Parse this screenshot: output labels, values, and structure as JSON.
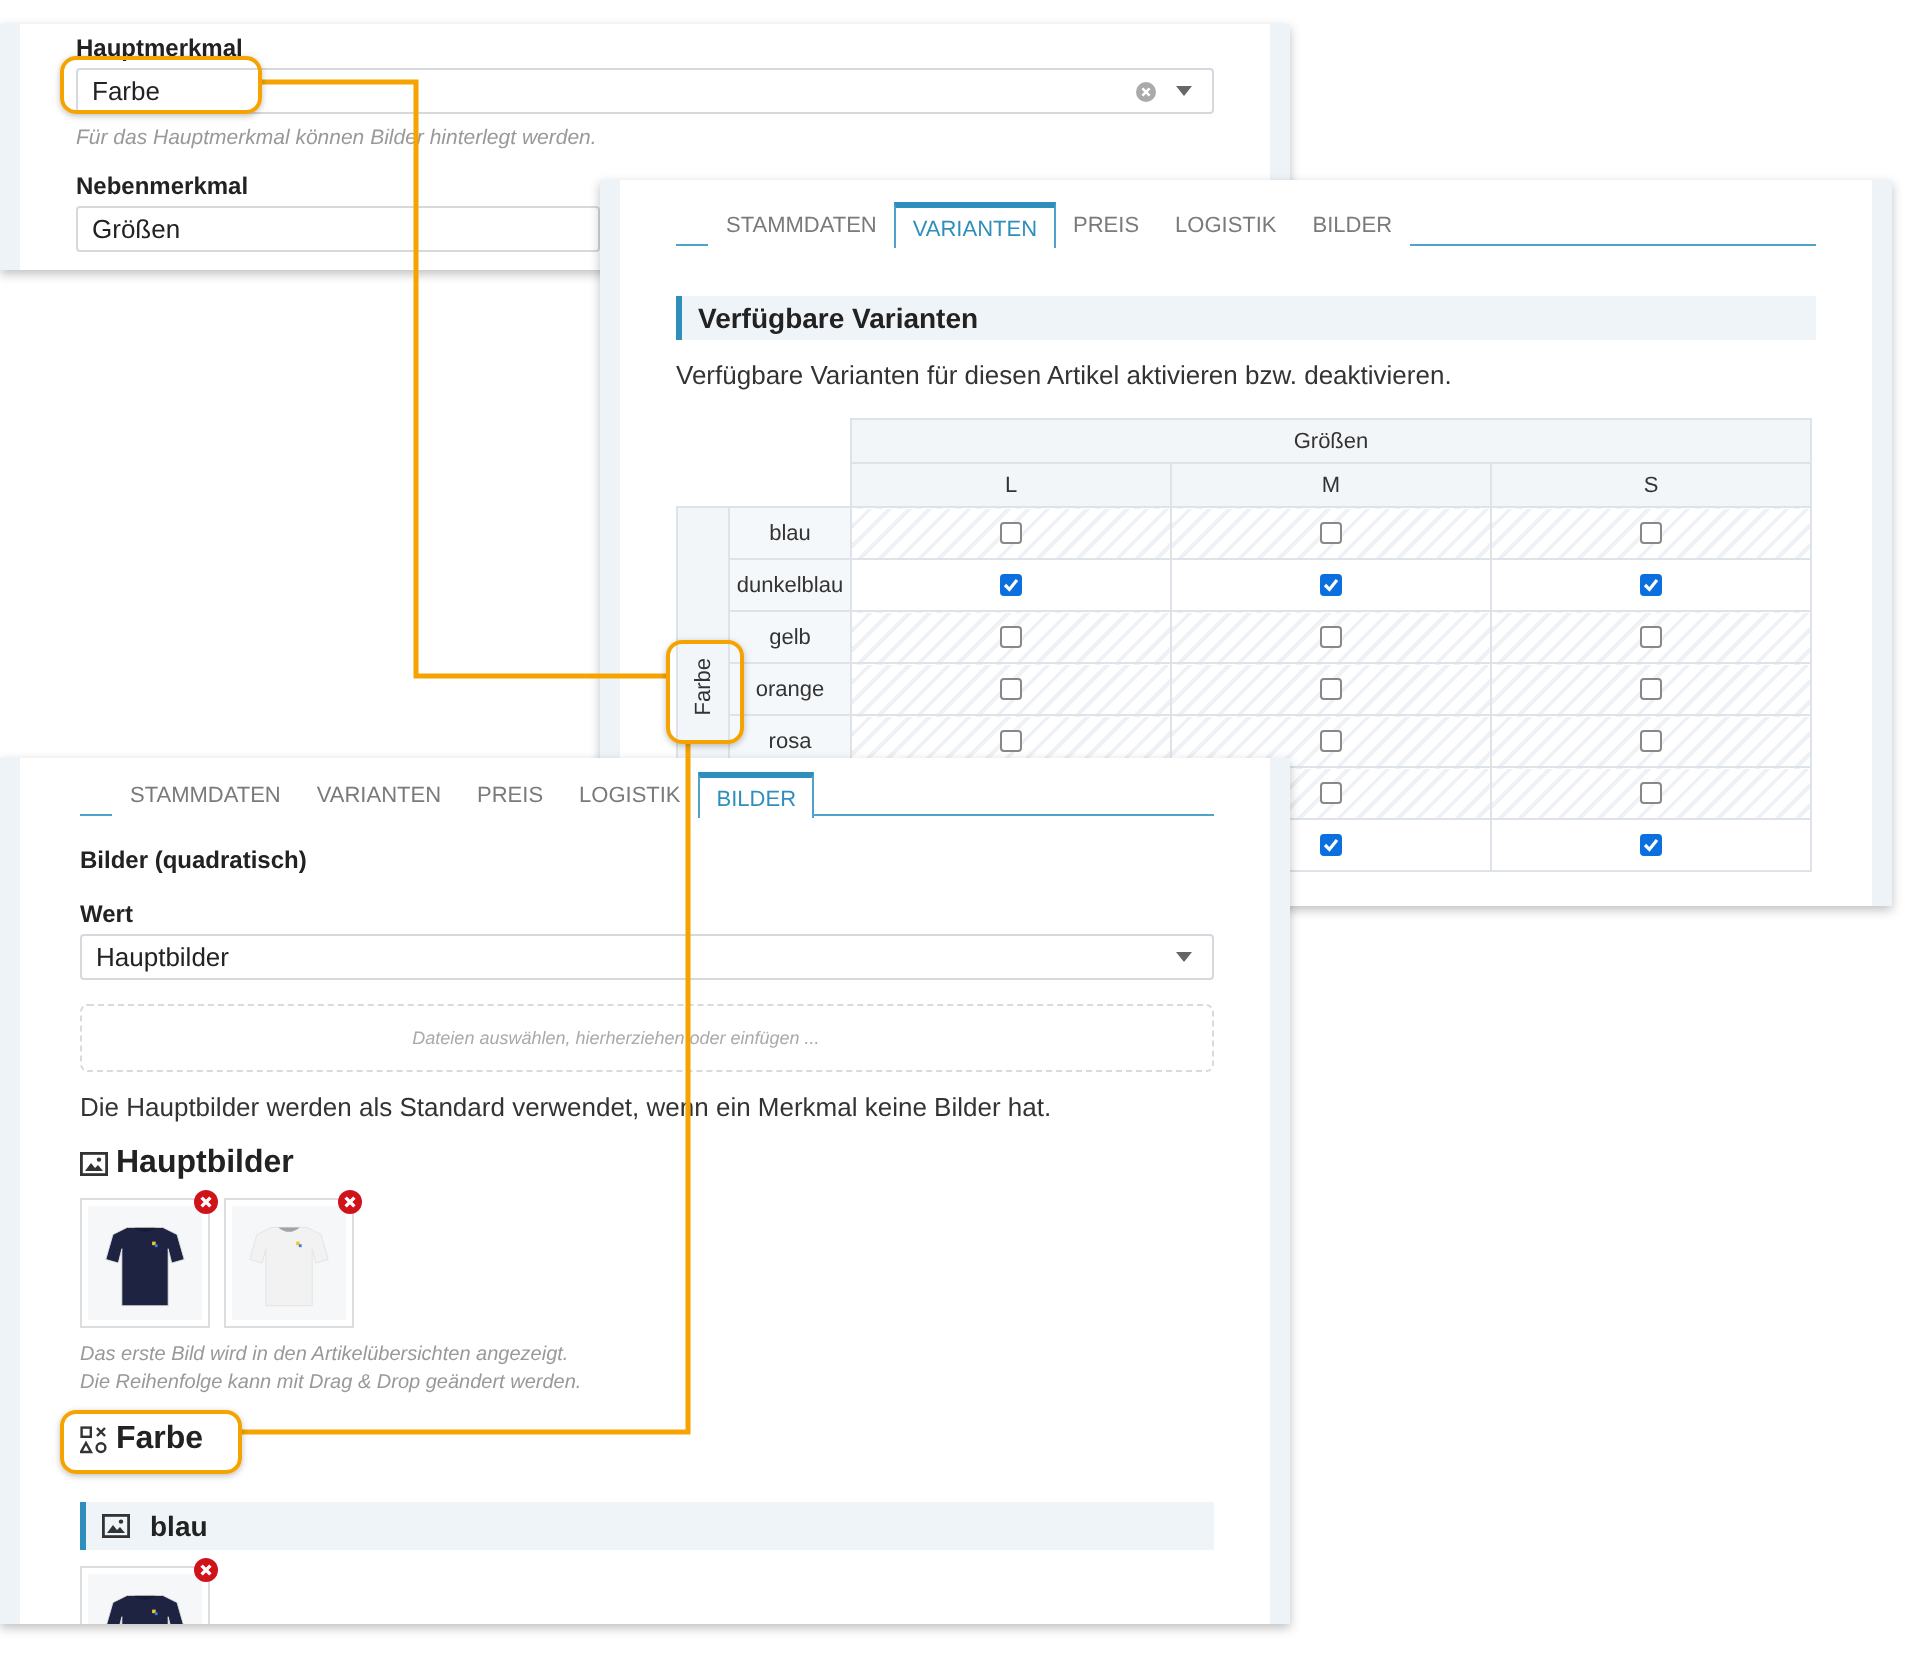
{
  "feature_panel": {
    "main": {
      "label": "Hauptmerkmal",
      "value": "Farbe",
      "hint": "Für das Hauptmerkmal können Bilder hinterlegt werden."
    },
    "secondary": {
      "label": "Nebenmerkmal",
      "value": "Größen"
    }
  },
  "variants_panel": {
    "tabs": [
      {
        "label": "STAMMDATEN",
        "selected": false
      },
      {
        "label": "VARIANTEN",
        "selected": true
      },
      {
        "label": "PREIS",
        "selected": false
      },
      {
        "label": "LOGISTIK",
        "selected": false
      },
      {
        "label": "BILDER",
        "selected": false
      }
    ],
    "section_title": "Verfügbare Varianten",
    "description": "Verfügbare Varianten für diesen Artikel aktivieren bzw. deaktivieren.",
    "table": {
      "column_group": "Größen",
      "columns": [
        "L",
        "M",
        "S"
      ],
      "row_group": "Farbe",
      "rows": [
        {
          "name": "blau",
          "cells": [
            {
              "checked": false
            },
            {
              "checked": false
            },
            {
              "checked": false
            }
          ]
        },
        {
          "name": "dunkelblau",
          "cells": [
            {
              "checked": true
            },
            {
              "checked": true
            },
            {
              "checked": true
            }
          ]
        },
        {
          "name": "gelb",
          "cells": [
            {
              "checked": false
            },
            {
              "checked": false
            },
            {
              "checked": false
            }
          ]
        },
        {
          "name": "orange",
          "cells": [
            {
              "checked": false
            },
            {
              "checked": false
            },
            {
              "checked": false
            }
          ]
        },
        {
          "name": "rosa",
          "cells": [
            {
              "checked": false
            },
            {
              "checked": false
            },
            {
              "checked": false
            }
          ]
        },
        {
          "cells": [
            null,
            {
              "checked": false
            },
            {
              "checked": false
            }
          ]
        },
        {
          "cells": [
            null,
            {
              "checked": true
            },
            {
              "checked": true
            }
          ]
        }
      ]
    }
  },
  "images_panel": {
    "tabs": [
      {
        "label": "STAMMDATEN",
        "selected": false
      },
      {
        "label": "VARIANTEN",
        "selected": false
      },
      {
        "label": "PREIS",
        "selected": false
      },
      {
        "label": "LOGISTIK",
        "selected": false
      },
      {
        "label": "BILDER",
        "selected": true
      }
    ],
    "title": "Bilder (quadratisch)",
    "field_label": "Wert",
    "select_value": "Hauptbilder",
    "dropzone_text": "Dateien auswählen, hierherziehen oder einfügen ...",
    "info": "Die Hauptbilder werden als Standard verwendet, wenn ein Merkmal keine Bilder hat.",
    "main_images": {
      "title": "Hauptbilder",
      "images": [
        {
          "kind": "picture",
          "color": "#1d2340"
        },
        {
          "kind": "picture",
          "color": "#f2f2f2"
        }
      ],
      "notes": [
        "Das erste Bild wird in den Artikelübersichten angezeigt.",
        "Die Reihenfolge kann mit Drag & Drop geändert werden."
      ]
    },
    "feature_title": "Farbe",
    "group": {
      "title": "blau",
      "images": [
        {
          "kind": "picture",
          "color": "#1d2340"
        }
      ]
    }
  }
}
